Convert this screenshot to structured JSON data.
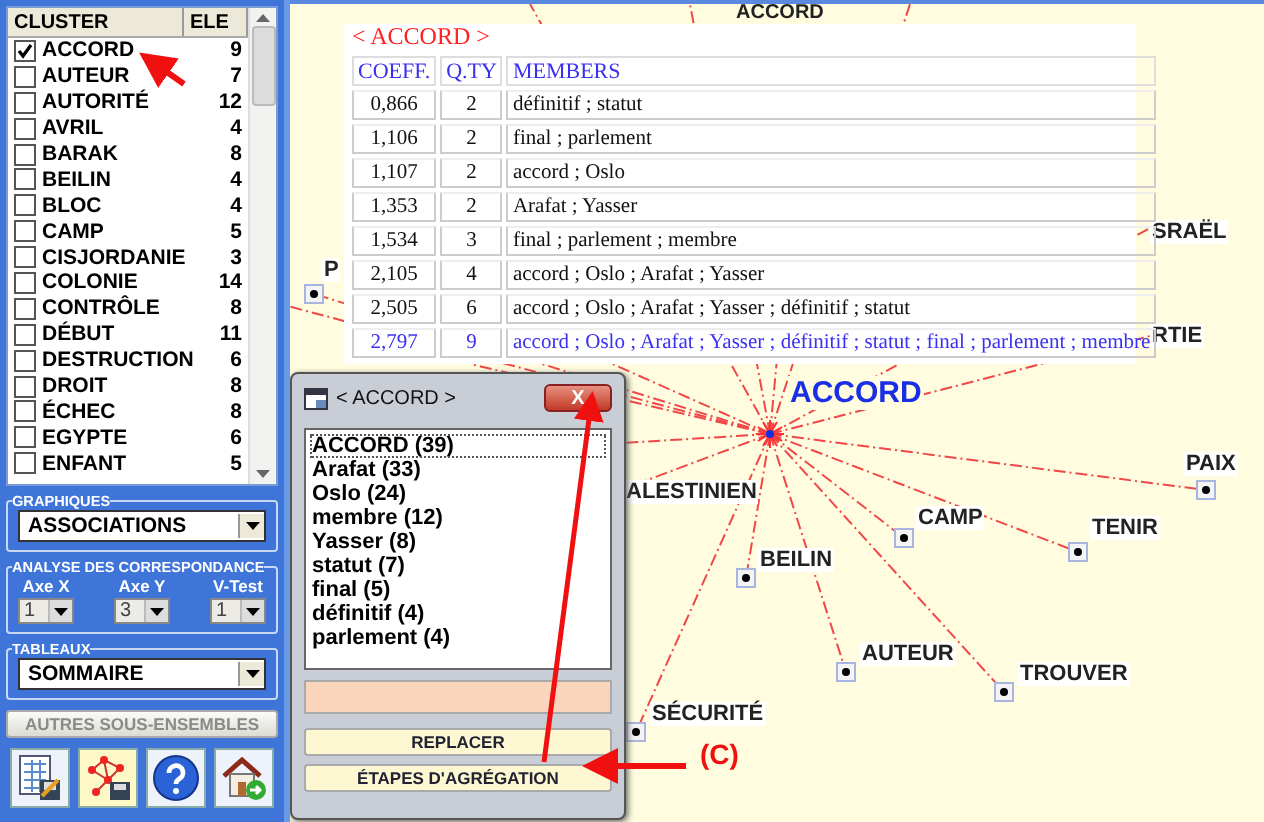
{
  "cluster_list": {
    "columns": [
      "CLUSTER",
      "ELE"
    ],
    "rows": [
      {
        "name": "ACCORD",
        "count": "9",
        "checked": true
      },
      {
        "name": "AUTEUR",
        "count": "7",
        "checked": false
      },
      {
        "name": "AUTORITÉ",
        "count": "12",
        "checked": false
      },
      {
        "name": "AVRIL",
        "count": "4",
        "checked": false
      },
      {
        "name": "BARAK",
        "count": "8",
        "checked": false
      },
      {
        "name": "BEILIN",
        "count": "4",
        "checked": false
      },
      {
        "name": "BLOC",
        "count": "4",
        "checked": false
      },
      {
        "name": "CAMP",
        "count": "5",
        "checked": false
      },
      {
        "name": "CISJORDANIE",
        "count": "3",
        "checked": false
      },
      {
        "name": "COLONIE",
        "count": "14",
        "checked": false
      },
      {
        "name": "CONTRÔLE",
        "count": "8",
        "checked": false
      },
      {
        "name": "DÉBUT",
        "count": "11",
        "checked": false
      },
      {
        "name": "DESTRUCTION",
        "count": "6",
        "checked": false
      },
      {
        "name": "DROIT",
        "count": "8",
        "checked": false
      },
      {
        "name": "ÉCHEC",
        "count": "8",
        "checked": false
      },
      {
        "name": "EGYPTE",
        "count": "6",
        "checked": false
      },
      {
        "name": "ENFANT",
        "count": "5",
        "checked": false
      }
    ]
  },
  "graphiques": {
    "legend": "GRAPHIQUES",
    "value": "ASSOCIATIONS"
  },
  "analyse": {
    "legend": "ANALYSE DES CORRESPONDANCE",
    "axes": [
      {
        "label": "Axe X",
        "value": "1",
        "disabled": true
      },
      {
        "label": "Axe Y",
        "value": "3",
        "disabled": true
      },
      {
        "label": "V-Test",
        "value": "1",
        "disabled": true
      }
    ]
  },
  "tableaux": {
    "legend": "TABLEAUX",
    "value": "SOMMAIRE"
  },
  "other_button": {
    "label": "AUTRES SOUS-ENSEMBLES",
    "disabled": true
  },
  "graph": {
    "labels": [
      {
        "kind": "center",
        "label": "ACCORD"
      },
      {
        "kind": "plain",
        "label": "ACCORD"
      },
      {
        "kind": "node",
        "label": "PAIX"
      },
      {
        "kind": "node",
        "label": "TENIR"
      },
      {
        "kind": "node",
        "label": "CAMP"
      },
      {
        "kind": "node",
        "label": "BEILIN"
      },
      {
        "kind": "node",
        "label": "AUTEUR"
      },
      {
        "kind": "node",
        "label": "TROUVER"
      },
      {
        "kind": "node",
        "label": "SÉCURITÉ"
      },
      {
        "kind": "plain",
        "label": "ALESTINIEN"
      },
      {
        "kind": "node",
        "label": "P"
      },
      {
        "kind": "plain",
        "label": "SRAËL"
      },
      {
        "kind": "plain",
        "label": "RTIE"
      }
    ]
  },
  "table_popup": {
    "title": "< ACCORD >",
    "columns": [
      "COEFF.",
      "Q.TY",
      "MEMBERS"
    ],
    "rows": [
      {
        "coeff": "0,866",
        "qty": "2",
        "members": "définitif ; statut",
        "selected": false
      },
      {
        "coeff": "1,106",
        "qty": "2",
        "members": "final ; parlement",
        "selected": false
      },
      {
        "coeff": "1,107",
        "qty": "2",
        "members": "accord ; Oslo",
        "selected": false
      },
      {
        "coeff": "1,353",
        "qty": "2",
        "members": "Arafat ; Yasser",
        "selected": false
      },
      {
        "coeff": "1,534",
        "qty": "3",
        "members": "final ; parlement ; membre",
        "selected": false
      },
      {
        "coeff": "2,105",
        "qty": "4",
        "members": "accord ; Oslo ; Arafat ; Yasser",
        "selected": false
      },
      {
        "coeff": "2,505",
        "qty": "6",
        "members": "accord ; Oslo ; Arafat ; Yasser ; définitif ; statut",
        "selected": false
      },
      {
        "coeff": "2,797",
        "qty": "9",
        "members": "accord ; Oslo ; Arafat ; Yasser ; définitif ; statut ; final ; parlement ; membre",
        "selected": true
      }
    ]
  },
  "window": {
    "title": "< ACCORD >",
    "close": "X",
    "items": [
      {
        "label": "ACCORD (39)",
        "selected": true
      },
      {
        "label": "Arafat (33)",
        "selected": false
      },
      {
        "label": "Oslo (24)",
        "selected": false
      },
      {
        "label": "membre (12)",
        "selected": false
      },
      {
        "label": "Yasser (8)",
        "selected": false
      },
      {
        "label": "statut (7)",
        "selected": false
      },
      {
        "label": "final (5)",
        "selected": false
      },
      {
        "label": "définitif (4)",
        "selected": false
      },
      {
        "label": "parlement (4)",
        "selected": false
      }
    ],
    "buttons": [
      "REPLACER",
      "ÉTAPES D'AGRÉGATION"
    ]
  },
  "annotation": {
    "label": "(C)"
  }
}
